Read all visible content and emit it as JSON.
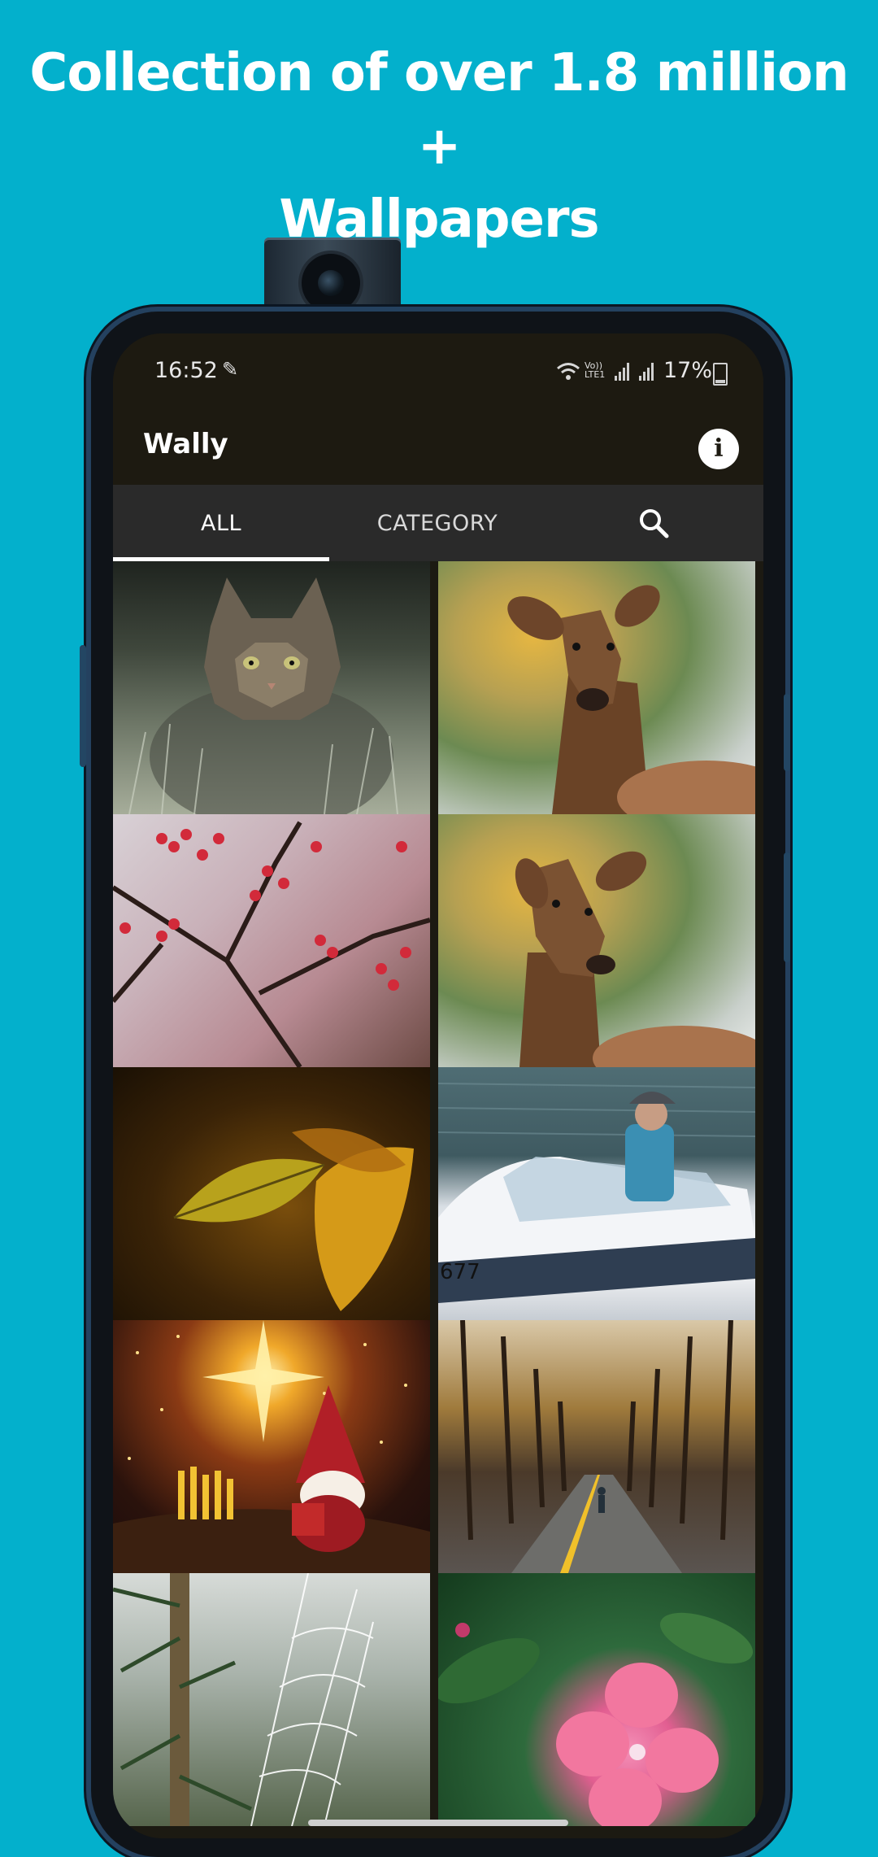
{
  "headline": {
    "line1": "Collection of over 1.8 million +",
    "line2": "Wallpapers"
  },
  "status_bar": {
    "time": "16:52",
    "volte_label": "Vo)) LTE1",
    "battery_percent": "17%",
    "icons": [
      "wifi-icon",
      "volte-icon",
      "signal-icon",
      "battery-icon"
    ]
  },
  "app_bar": {
    "title": "Wally",
    "info_glyph": "i"
  },
  "tabs": [
    {
      "label": "ALL",
      "active": true
    },
    {
      "label": "CATEGORY",
      "active": false
    },
    {
      "label": "",
      "icon": "search-icon",
      "active": false
    }
  ],
  "wallpapers": [
    {
      "subject": "tabby cat in frosty grass"
    },
    {
      "subject": "deer portrait with autumn trees"
    },
    {
      "subject": "red berries on branch"
    },
    {
      "subject": "deer portrait with autumn trees"
    },
    {
      "subject": "autumn leaf"
    },
    {
      "subject": "person in speedboat",
      "visible_text": "677"
    },
    {
      "subject": "christmas gnome with star"
    },
    {
      "subject": "tree-lined road in autumn"
    },
    {
      "subject": "frosted spider web on pine"
    },
    {
      "subject": "pink flower"
    }
  ],
  "colors": {
    "background": "#03b0cc",
    "app_bar": "#1d1a11",
    "tab_bar": "#2a2a2a",
    "tab_indicator": "#ffffff"
  }
}
